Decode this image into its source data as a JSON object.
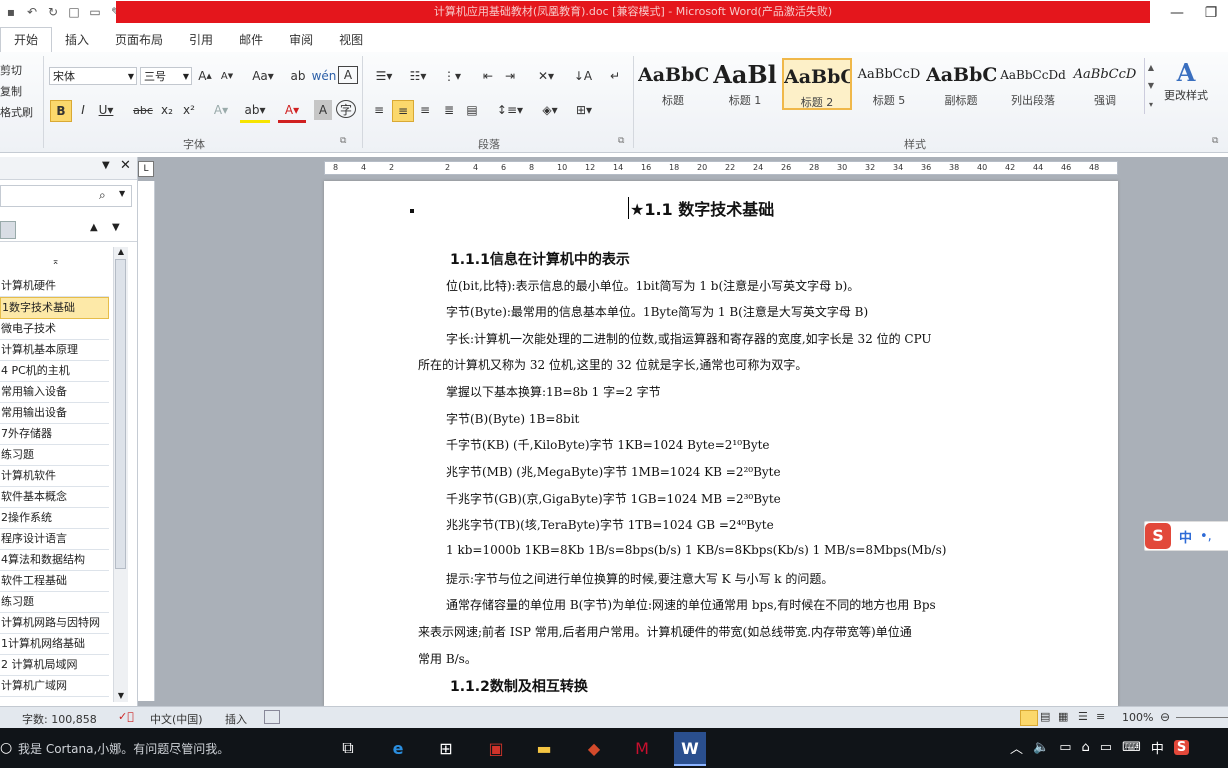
{
  "window": {
    "title": "计算机应用基础教材(凤凰教育).doc [兼容模式] - Microsoft Word(产品激活失败)"
  },
  "qat": {
    "items": [
      "undo",
      "redo",
      "new",
      "open",
      "edit"
    ]
  },
  "tabs": [
    "开始",
    "插入",
    "页面布局",
    "引用",
    "邮件",
    "审阅",
    "视图"
  ],
  "clipboard": {
    "cut": "剪切",
    "copy": "复制",
    "format_painter": "格式刷"
  },
  "font": {
    "name": "宋体",
    "size": "三号",
    "group_label": "字体"
  },
  "paragraph": {
    "group_label": "段落"
  },
  "styles": {
    "group_label": "样式",
    "items": [
      {
        "preview": "AaBbC",
        "name": "标题"
      },
      {
        "preview": "AaBl",
        "name": "标题 1"
      },
      {
        "preview": "AaBbC",
        "name": "标题 2"
      },
      {
        "preview": "AaBbCcD",
        "name": "标题 5"
      },
      {
        "preview": "AaBbC",
        "name": "副标题"
      },
      {
        "preview": "AaBbCcDd",
        "name": "列出段落"
      },
      {
        "preview": "AaBbCcD",
        "name": "强调"
      }
    ],
    "change_label": "更改样式"
  },
  "ruler": {
    "numbers": [
      "8",
      "4",
      "2",
      "",
      "2",
      "4",
      "6",
      "8",
      "10",
      "12",
      "14",
      "16",
      "18",
      "20",
      "22",
      "24",
      "26",
      "28",
      "30",
      "32",
      "34",
      "36",
      "38",
      "40",
      "42",
      "44",
      "46",
      "48"
    ]
  },
  "nav": {
    "items": [
      "计算机硬件",
      "1数字技术基础",
      "微电子技术",
      "计算机基本原理",
      "4 PC机的主机",
      "常用输入设备",
      "常用输出设备",
      "7外存储器",
      "练习题",
      " 计算机软件",
      "软件基本概念",
      "2操作系统",
      "程序设计语言",
      "4算法和数据结构",
      "软件工程基础",
      "练习题",
      "计算机网路与因特网",
      "1计算机网络基础",
      "2 计算机局域网",
      "计算机广域网"
    ],
    "selected_index": 1
  },
  "document": {
    "lines": [
      {
        "text": "★1.1 数字技术基础",
        "style": "h1"
      },
      {
        "text": "1.1.1信息在计算机中的表示",
        "style": "h2"
      },
      {
        "text": "位(bit,比特):表示信息的最小单位。1bit简写为 1 b(注意是小写英文字母 b)。",
        "style": "p"
      },
      {
        "text": "字节(Byte):最常用的信息基本单位。1Byte简写为 1 B(注意是大写英文字母 B)",
        "style": "p"
      },
      {
        "text": "字长:计算机一次能处理的二进制的位数,或指运算器和寄存器的宽度,如字长是 32 位的 CPU",
        "style": "p"
      },
      {
        "text": "所在的计算机又称为 32 位机,这里的 32 位就是字长,通常也可称为双字。",
        "style": "pc"
      },
      {
        "text": "掌握以下基本换算:1B=8b    1 字=2 字节",
        "style": "p"
      },
      {
        "text": "字节(B)(Byte)     1B=8bit",
        "style": "p"
      },
      {
        "text": "千字节(KB)  (千,KiloByte)字节  1KB=1024 Byte=2¹⁰Byte",
        "style": "p"
      },
      {
        "text": "兆字节(MB)  (兆,MegaByte)字节  1MB=1024 KB  =2²⁰Byte",
        "style": "p"
      },
      {
        "text": "千兆字节(GB)(京,GigaByte)字节  1GB=1024 MB  =2³⁰Byte",
        "style": "p"
      },
      {
        "text": "兆兆字节(TB)(垓,TeraByte)字节  1TB=1024 GB  =2⁴⁰Byte",
        "style": "p"
      },
      {
        "text": "1 kb=1000b  1KB=8Kb  1B/s=8bps(b/s)  1 KB/s=8Kbps(Kb/s)  1 MB/s=8Mbps(Mb/s)",
        "style": "p"
      },
      {
        "text": "提示:字节与位之间进行单位换算的时候,要注意大写 K 与小写 k 的问题。",
        "style": "p"
      },
      {
        "text": "通常存储容量的单位用 B(字节)为单位:网速的单位通常用 bps,有时候在不同的地方也用 Bps",
        "style": "p"
      },
      {
        "text": "来表示网速;前者 ISP 常用,后者用户常用。计算机硬件的带宽(如总线带宽.内存带宽等)单位通",
        "style": "pc"
      },
      {
        "text": "常用 B/s。",
        "style": "pc"
      },
      {
        "text": "1.1.2数制及相互转换",
        "style": "h2"
      }
    ]
  },
  "status": {
    "word_count": "字数: 100,858",
    "language": "中文(中国)",
    "mode": "插入",
    "zoom": "100%"
  },
  "taskbar": {
    "cortana": "我是 Cortana,小娜。有问题尽管问我。",
    "ime": "中"
  },
  "ime_floating": "中"
}
